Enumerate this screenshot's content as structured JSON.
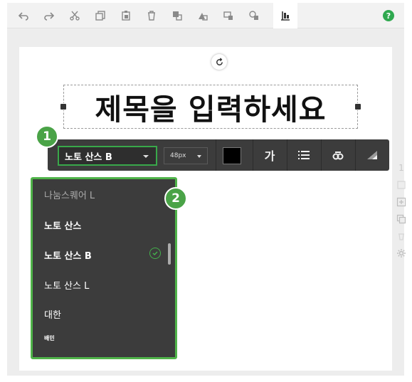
{
  "toolbar": {
    "buttons": [
      {
        "name": "undo-icon"
      },
      {
        "name": "redo-icon"
      },
      {
        "name": "cut-icon"
      },
      {
        "name": "copy-icon"
      },
      {
        "name": "paste-icon"
      },
      {
        "name": "delete-icon"
      },
      {
        "name": "bring-forward-icon"
      },
      {
        "name": "send-backward-icon"
      },
      {
        "name": "group-icon"
      },
      {
        "name": "ungroup-icon"
      },
      {
        "name": "align-icon"
      }
    ],
    "help_label": "?"
  },
  "canvas": {
    "title_text": "제목을 입력하세요"
  },
  "format_bar": {
    "font_value": "노토 산스 B",
    "size_value": "48px",
    "text_color": "#000000",
    "text_style_label": "가"
  },
  "badges": {
    "first": "1",
    "second": "2"
  },
  "font_dropdown": {
    "options": [
      {
        "label": "나눔스퀘어 L",
        "selected": false
      },
      {
        "label": "노토 산스",
        "selected": false
      },
      {
        "label": "노토 산스 B",
        "selected": true
      },
      {
        "label": "노토 산스 L",
        "selected": false
      },
      {
        "label": "대한",
        "selected": false
      },
      {
        "label": "배민",
        "selected": false
      }
    ]
  },
  "side_panel": {
    "page_number": "1"
  },
  "colors": {
    "accent_green": "#4aa347",
    "toolbar_dark": "#3c3c3c"
  }
}
